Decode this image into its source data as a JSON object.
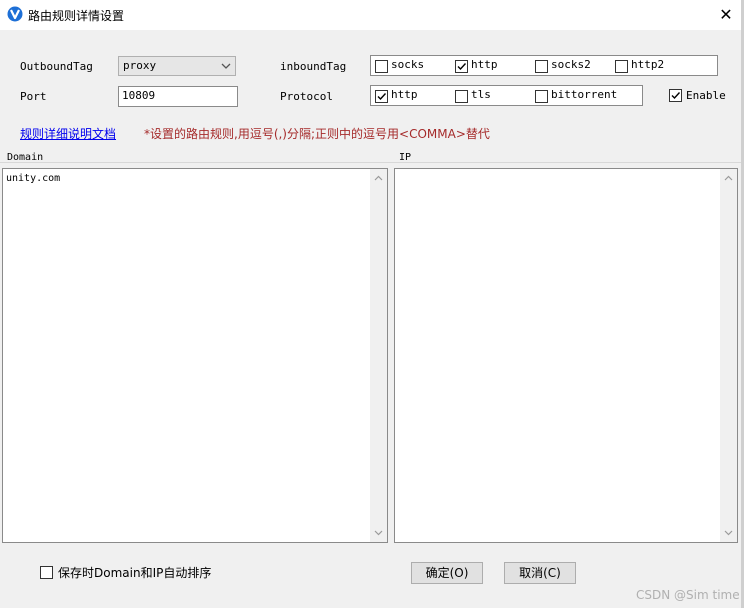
{
  "window": {
    "title": "路由规则详情设置"
  },
  "form": {
    "outbound_tag_label": "OutboundTag",
    "outbound_tag_value": "proxy",
    "port_label": "Port",
    "port_value": "10809",
    "inbound_tag_label": "inboundTag",
    "inbound_options": [
      {
        "label": "socks",
        "checked": false
      },
      {
        "label": "http",
        "checked": true
      },
      {
        "label": "socks2",
        "checked": false
      },
      {
        "label": "http2",
        "checked": false
      }
    ],
    "protocol_label": "Protocol",
    "protocol_options": [
      {
        "label": "http",
        "checked": true
      },
      {
        "label": "tls",
        "checked": false
      },
      {
        "label": "bittorrent",
        "checked": false
      }
    ],
    "enable_label": "Enable",
    "enable_checked": true
  },
  "help": {
    "link_text": "规则详细说明文档",
    "note": "*设置的路由规则,用逗号(,)分隔;正则中的逗号用<COMMA>替代"
  },
  "domain": {
    "label": "Domain",
    "value": "unity.com"
  },
  "ip": {
    "label": "IP",
    "value": ""
  },
  "footer": {
    "sort_label": "保存时Domain和IP自动排序",
    "sort_checked": false,
    "ok_label": "确定(O)",
    "cancel_label": "取消(C)"
  },
  "watermark": "CSDN @Sim time"
}
